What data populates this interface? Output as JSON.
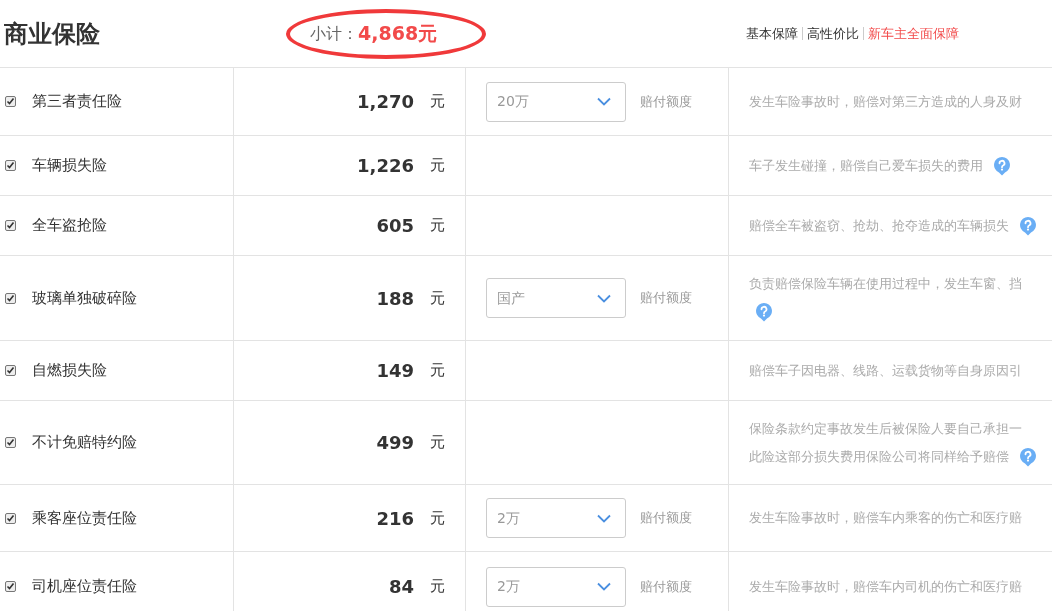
{
  "title": "商业保险",
  "subtotal": {
    "label": "小计：",
    "value": "4,868元",
    "circled": true
  },
  "plans": [
    {
      "label": "基本保障",
      "selected": false
    },
    {
      "label": "高性价比",
      "selected": false
    },
    {
      "label": "新车主全面保障",
      "selected": true
    }
  ],
  "rows": [
    {
      "name": "第三者责任险",
      "checked": true,
      "price": "1,270",
      "unit": "元",
      "select": {
        "value": "20万",
        "note": "赔付额度"
      },
      "description": [
        "发生车险事故时，赔偿对第三方造成的人身及财"
      ],
      "help": false
    },
    {
      "name": "车辆损失险",
      "checked": true,
      "price": "1,226",
      "unit": "元",
      "description": [
        "车子发生碰撞，赔偿自己爱车损失的费用"
      ],
      "help": true
    },
    {
      "name": "全车盗抢险",
      "checked": true,
      "price": "605",
      "unit": "元",
      "description": [
        "赔偿全车被盗窃、抢劫、抢夺造成的车辆损失"
      ],
      "help": true
    },
    {
      "name": "玻璃单独破碎险",
      "checked": true,
      "price": "188",
      "unit": "元",
      "select": {
        "value": "国产",
        "note": "赔付额度"
      },
      "description": [
        "负责赔偿保险车辆在使用过程中，发生车窗、挡"
      ],
      "help": true
    },
    {
      "name": "自燃损失险",
      "checked": true,
      "price": "149",
      "unit": "元",
      "description": [
        "赔偿车子因电器、线路、运载货物等自身原因引"
      ],
      "help": false
    },
    {
      "name": "不计免赔特约险",
      "checked": true,
      "price": "499",
      "unit": "元",
      "description": [
        "保险条款约定事故发生后被保险人要自己承担一",
        "此险这部分损失费用保险公司将同样给予赔偿"
      ],
      "help": true
    },
    {
      "name": "乘客座位责任险",
      "checked": true,
      "price": "216",
      "unit": "元",
      "select": {
        "value": "2万",
        "note": "赔付额度"
      },
      "description": [
        "发生车险事故时，赔偿车内乘客的伤亡和医疗赔"
      ],
      "help": false
    },
    {
      "name": "司机座位责任险",
      "checked": true,
      "price": "84",
      "unit": "元",
      "select": {
        "value": "2万",
        "note": "赔付额度"
      },
      "description": [
        "发生车险事故时，赔偿车内司机的伤亡和医疗赔"
      ],
      "help": false
    }
  ]
}
